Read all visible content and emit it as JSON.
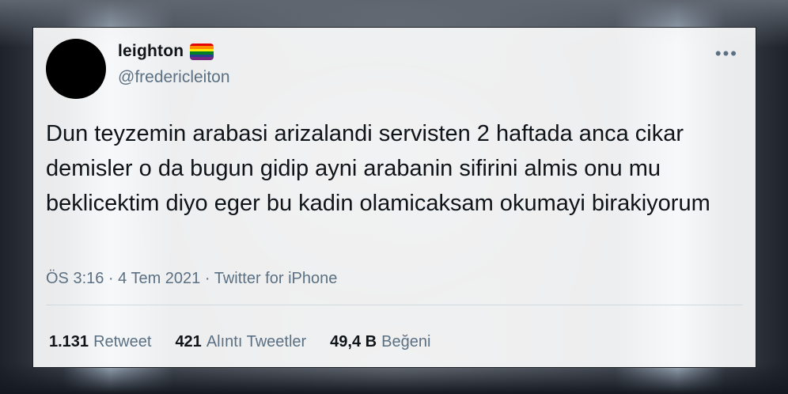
{
  "tweet": {
    "display_name": "leighton",
    "flag": "rainbow-flag",
    "flag_colors": [
      "#e40303",
      "#ff8c00",
      "#ffed00",
      "#008026",
      "#24408e",
      "#732982"
    ],
    "handle": "@fredericleiton",
    "more_icon": "more-horizontal-icon",
    "text": "Dun teyzemin arabasi arizalandi servisten 2 haftada anca cikar demisler o da bugun gidip ayni arabanin sifirini almis onu mu beklicektim diyo eger bu kadin olamicaksam okumayi birakiyorum",
    "meta": "ÖS 3:16 · 4 Tem 2021 · Twitter for iPhone",
    "stats": {
      "retweets_count": "1.131",
      "retweets_label": "Retweet",
      "quotes_count": "421",
      "quotes_label": "Alıntı Tweetler",
      "likes_count": "49,4 B",
      "likes_label": "Beğeni"
    }
  },
  "colors": {
    "text_primary": "#0f1419",
    "text_secondary": "#5b7083",
    "avatar": "#000000"
  }
}
